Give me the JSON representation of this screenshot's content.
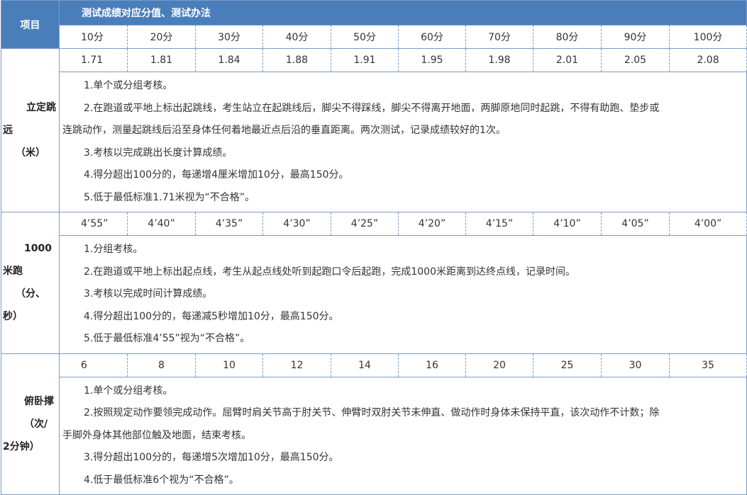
{
  "header": {
    "project_label": "项目",
    "title": "测试成绩对应分值、测试办法",
    "scores": [
      "10分",
      "20分",
      "30分",
      "40分",
      "50分",
      "60分",
      "70分",
      "80分",
      "90分",
      "100分"
    ]
  },
  "sections": [
    {
      "label_lines": [
        "立定跳",
        "远",
        "（米）"
      ],
      "values": [
        "1.71",
        "1.81",
        "1.84",
        "1.88",
        "1.91",
        "1.95",
        "1.98",
        "2.01",
        "2.05",
        "2.08"
      ],
      "rules": [
        "1.单个或分组考核。",
        "2.在跑道或平地上标出起跳线，考生站立在起跳线后，脚尖不得踩线，脚尖不得离开地面，两脚原地同时起跳，不得有助跑、垫步或",
        "连跳动作，测量起跳线后沿至身体任何着地最近点后沿的垂直距离。两次测试，记录成绩较好的1次。",
        "3.考核以完成跳出长度计算成绩。",
        "4.得分超出100分的，每递增4厘米增加10分，最高150分。",
        "5.低于最低标准1.71米视为“不合格”。"
      ]
    },
    {
      "label_lines": [
        "1000",
        "米跑",
        "（分、",
        "秒）"
      ],
      "values": [
        "4’55”",
        "4’40”",
        "4’35”",
        "4’30”",
        "4’25”",
        "4’20”",
        "4’15”",
        "4’10”",
        "4’05”",
        "4’00”"
      ],
      "rules": [
        "1.分组考核。",
        "2.在跑道或平地上标出起点线，考生从起点线处听到起跑口令后起跑，完成1000米距离到达终点线，记录时间。",
        "3.考核以完成时间计算成绩。",
        "4.得分超出100分的，每递减5秒增加10分，最高150分。",
        "5.低于最低标准4’55”视为“不合格”。"
      ]
    },
    {
      "label_lines": [
        "俯卧撑",
        "（次/",
        "2分钟）"
      ],
      "values": [
        "6",
        "8",
        "10",
        "12",
        "14",
        "16",
        "20",
        "25",
        "30",
        "35"
      ],
      "rules": [
        "1.单个或分组考核。",
        "2.按照规定动作要领完成动作。屈臂时肩关节高于肘关节、伸臂时双肘关节未伸直、做动作时身体未保持平直，该次动作不计数；除",
        "手脚外身体其他部位触及地面，结束考核。",
        "3.得分超出100分的，每递增5次增加10分，最高150分。",
        "4.低于最低标准6个视为“不合格”。"
      ]
    }
  ]
}
